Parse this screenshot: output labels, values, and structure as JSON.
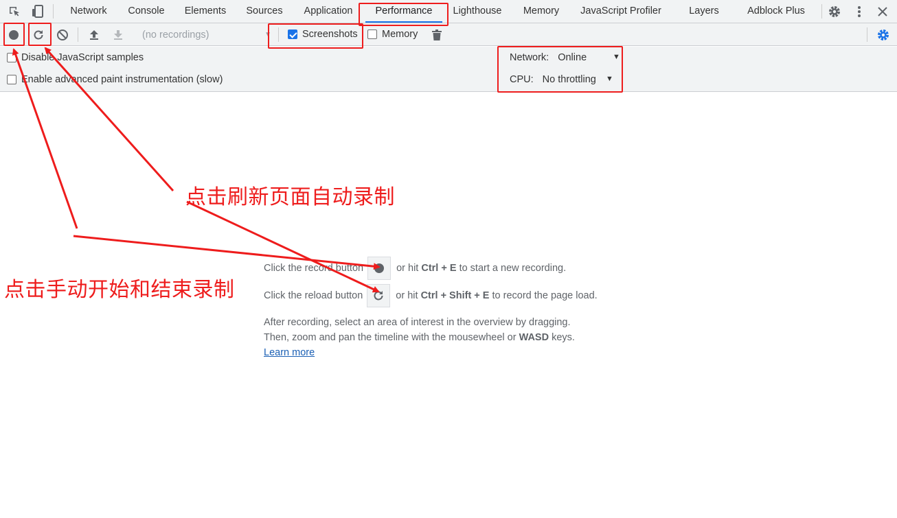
{
  "tabs": [
    {
      "label": "Network"
    },
    {
      "label": "Console"
    },
    {
      "label": "Elements"
    },
    {
      "label": "Sources"
    },
    {
      "label": "Application"
    },
    {
      "label": "Performance",
      "active": true
    },
    {
      "label": "Lighthouse"
    },
    {
      "label": "Memory"
    },
    {
      "label": "JavaScript Profiler"
    },
    {
      "label": "Layers"
    },
    {
      "label": "Adblock Plus"
    }
  ],
  "tabbar_icons": [
    "inspect-element-icon",
    "device-toolbar-icon",
    "gear-icon",
    "more-vertical-icon",
    "close-icon"
  ],
  "toolbar": {
    "recordings_placeholder": "(no recordings)",
    "screenshots_label": "Screenshots",
    "screenshots_checked": true,
    "memory_label": "Memory",
    "memory_checked": false
  },
  "settings": {
    "disable_js_samples": "Disable JavaScript samples",
    "advanced_paint": "Enable advanced paint instrumentation (slow)",
    "network_label": "Network:",
    "network_value": "Online",
    "cpu_label": "CPU:",
    "cpu_value": "No throttling"
  },
  "landing": {
    "record_prefix": "Click the record button",
    "record_mid": "or hit",
    "record_keys": "Ctrl + E",
    "record_suffix": "to start a new recording.",
    "reload_prefix": "Click the reload button",
    "reload_mid": "or hit",
    "reload_keys": "Ctrl + Shift + E",
    "reload_suffix": "to record the page load.",
    "after_line1": "After recording, select an area of interest in the overview by dragging.",
    "after_line2_prefix": "Then, zoom and pan the timeline with the mousewheel or",
    "after_line2_keys": "WASD",
    "after_line2_suffix": "keys.",
    "learn_more": "Learn more"
  },
  "annotations": {
    "reload_note": "点击刷新页面自动录制",
    "record_note": "点击手动开始和结束录制"
  },
  "colors": {
    "annotation": "#ee1c1c",
    "accent": "#1a73e8",
    "toolbar_bg": "#f1f3f4"
  }
}
